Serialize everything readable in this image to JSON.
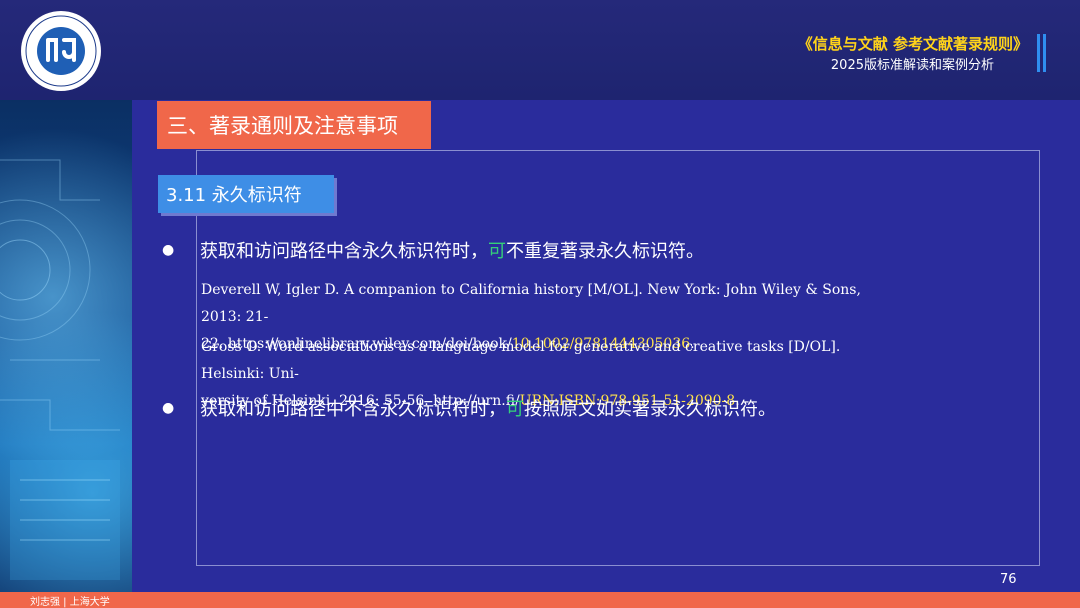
{
  "header": {
    "logo_alt": "logo",
    "title": "《信息与文献  参考文献著录规则》",
    "subtitle": "2025版标准解读和案例分析"
  },
  "section": {
    "title": "三、著录通则及注意事项",
    "subsection": "3.11  永久标识符"
  },
  "bullets": [
    {
      "dot": "●",
      "text_before": "获取和访问路径中含永久标识符时，",
      "highlight": "可",
      "text_after": "不重复著录永久标识符。"
    },
    {
      "dot": "●",
      "text_before": "获取和访问路径中不含永久标识符时，",
      "highlight": "可",
      "text_after": "按照原文如实著录永久标识符。"
    }
  ],
  "references": [
    {
      "line1": "Deverell W, Igler D. A companion to California history [M/OL]. New York: John Wiley & Sons, 2013: 21-",
      "line2_plain": "22. https://onlinelibrary.wiley.com/doi/book/",
      "line2_highlight": "10.1002/9781444305036",
      "line2_end": "."
    },
    {
      "line1": "Gross O. Word associations as a language model for generative and creative tasks [D/OL]. Helsinki: Uni-",
      "line2_plain": "versity of Helsinki, 2016: 55-56. http://urn.fi/",
      "line2_highlight": "URN:ISBN:978-951-51-2090-8",
      "line2_end": "."
    }
  ],
  "footer": {
    "page_number": "76",
    "credit": "刘志强 | 上海大学"
  },
  "colors": {
    "background": "#2a2c9c",
    "accent_orange": "#f0674a",
    "accent_blue": "#3e8ee6",
    "title_yellow": "#ffd31a",
    "highlight_green": "#35d07a",
    "highlight_yellow": "#ffe24a"
  }
}
